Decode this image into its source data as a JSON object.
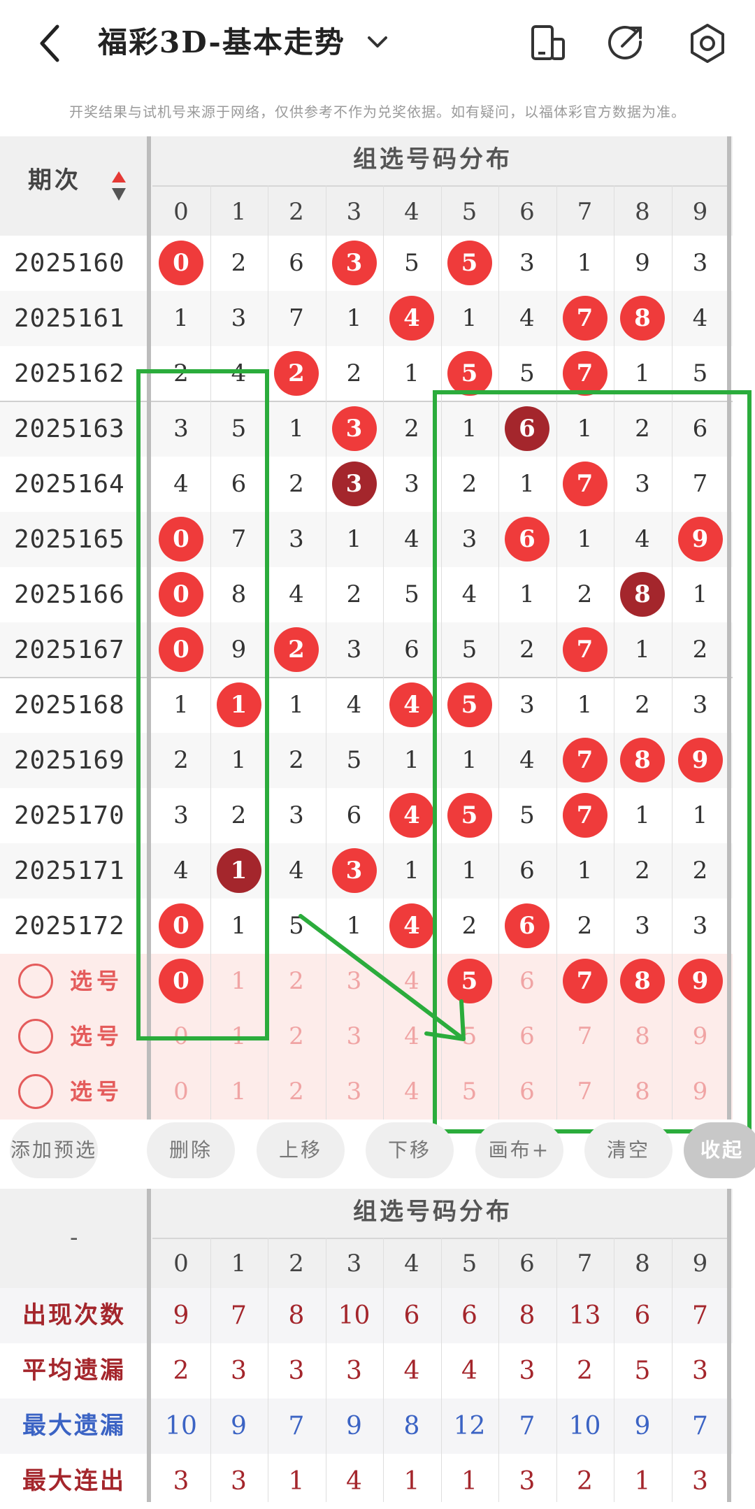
{
  "header": {
    "title": "福彩3D-基本走势",
    "notice": "开奖结果与试机号来源于网络，仅供参考不作为兑奖依据。如有疑问，以福体彩官方数据为准。"
  },
  "table": {
    "period_header": "期次",
    "group_header": "组选号码分布",
    "digits": [
      "0",
      "1",
      "2",
      "3",
      "4",
      "5",
      "6",
      "7",
      "8",
      "9"
    ],
    "rows": [
      {
        "period": "2025160",
        "cells": [
          "0",
          "2",
          "6",
          "3",
          "5",
          "5",
          "3",
          "1",
          "9",
          "3"
        ],
        "hits": {
          "0": "red",
          "3": "red",
          "5": "red"
        }
      },
      {
        "period": "2025161",
        "cells": [
          "1",
          "3",
          "7",
          "1",
          "4",
          "1",
          "4",
          "7",
          "8",
          "4"
        ],
        "hits": {
          "4": "red",
          "7": "red",
          "8": "red"
        }
      },
      {
        "period": "2025162",
        "cells": [
          "2",
          "4",
          "2",
          "2",
          "1",
          "5",
          "5",
          "7",
          "1",
          "5"
        ],
        "hits": {
          "2": "red",
          "5": "red",
          "7": "red"
        }
      },
      {
        "period": "2025163",
        "cells": [
          "3",
          "5",
          "1",
          "3",
          "2",
          "1",
          "6",
          "1",
          "2",
          "6"
        ],
        "hits": {
          "3": "red",
          "6": "dark"
        }
      },
      {
        "period": "2025164",
        "cells": [
          "4",
          "6",
          "2",
          "3",
          "3",
          "2",
          "1",
          "7",
          "3",
          "7"
        ],
        "hits": {
          "3": "dark",
          "7": "red"
        }
      },
      {
        "period": "2025165",
        "cells": [
          "0",
          "7",
          "3",
          "1",
          "4",
          "3",
          "6",
          "1",
          "4",
          "9"
        ],
        "hits": {
          "0": "red",
          "6": "red",
          "9": "red"
        }
      },
      {
        "period": "2025166",
        "cells": [
          "0",
          "8",
          "4",
          "2",
          "5",
          "4",
          "1",
          "2",
          "8",
          "1"
        ],
        "hits": {
          "0": "red",
          "8": "dark"
        }
      },
      {
        "period": "2025167",
        "cells": [
          "0",
          "9",
          "2",
          "3",
          "6",
          "5",
          "2",
          "7",
          "1",
          "2"
        ],
        "hits": {
          "0": "red",
          "2": "red",
          "7": "red"
        }
      },
      {
        "period": "2025168",
        "cells": [
          "1",
          "1",
          "1",
          "4",
          "4",
          "5",
          "3",
          "1",
          "2",
          "3"
        ],
        "hits": {
          "1": "red",
          "4": "red",
          "5": "red"
        }
      },
      {
        "period": "2025169",
        "cells": [
          "2",
          "1",
          "2",
          "5",
          "1",
          "1",
          "4",
          "7",
          "8",
          "9"
        ],
        "hits": {
          "7": "red",
          "8": "red",
          "9": "red"
        }
      },
      {
        "period": "2025170",
        "cells": [
          "3",
          "2",
          "3",
          "6",
          "4",
          "5",
          "5",
          "7",
          "1",
          "1"
        ],
        "hits": {
          "4": "red",
          "5": "red",
          "7": "red"
        }
      },
      {
        "period": "2025171",
        "cells": [
          "4",
          "1",
          "4",
          "3",
          "1",
          "1",
          "6",
          "1",
          "2",
          "2"
        ],
        "hits": {
          "1": "dark",
          "3": "red"
        }
      },
      {
        "period": "2025172",
        "cells": [
          "0",
          "1",
          "5",
          "1",
          "4",
          "2",
          "6",
          "2",
          "3",
          "3"
        ],
        "hits": {
          "0": "red",
          "4": "red",
          "6": "red"
        }
      }
    ],
    "picks": [
      {
        "label": "选号",
        "selected": [
          "0",
          "5",
          "7",
          "8",
          "9"
        ]
      },
      {
        "label": "选号",
        "selected": []
      },
      {
        "label": "选号",
        "selected": []
      }
    ]
  },
  "buttons": [
    "添加预选",
    "删除",
    "上移",
    "下移",
    "画布+",
    "清空",
    "收起"
  ],
  "stats": {
    "blank_label": "-",
    "group_header": "组选号码分布",
    "digits": [
      "0",
      "1",
      "2",
      "3",
      "4",
      "5",
      "6",
      "7",
      "8",
      "9"
    ],
    "rows": [
      {
        "label": "出现次数",
        "color": "#a4262c",
        "values": [
          "9",
          "7",
          "8",
          "10",
          "6",
          "6",
          "8",
          "13",
          "6",
          "7"
        ]
      },
      {
        "label": "平均遗漏",
        "color": "#a4262c",
        "values": [
          "2",
          "3",
          "3",
          "3",
          "4",
          "4",
          "3",
          "2",
          "5",
          "3"
        ]
      },
      {
        "label": "最大遗漏",
        "color": "#3b63c4",
        "values": [
          "10",
          "9",
          "7",
          "9",
          "8",
          "12",
          "7",
          "10",
          "9",
          "7"
        ]
      },
      {
        "label": "最大连出",
        "color": "#a4262c",
        "values": [
          "3",
          "3",
          "1",
          "4",
          "1",
          "1",
          "3",
          "2",
          "1",
          "3"
        ]
      }
    ]
  },
  "colors": {
    "accent": "#ef3b3b",
    "dark": "#a4262c",
    "annotation": "#2bac3c",
    "pick_bg": "#fdecea"
  }
}
